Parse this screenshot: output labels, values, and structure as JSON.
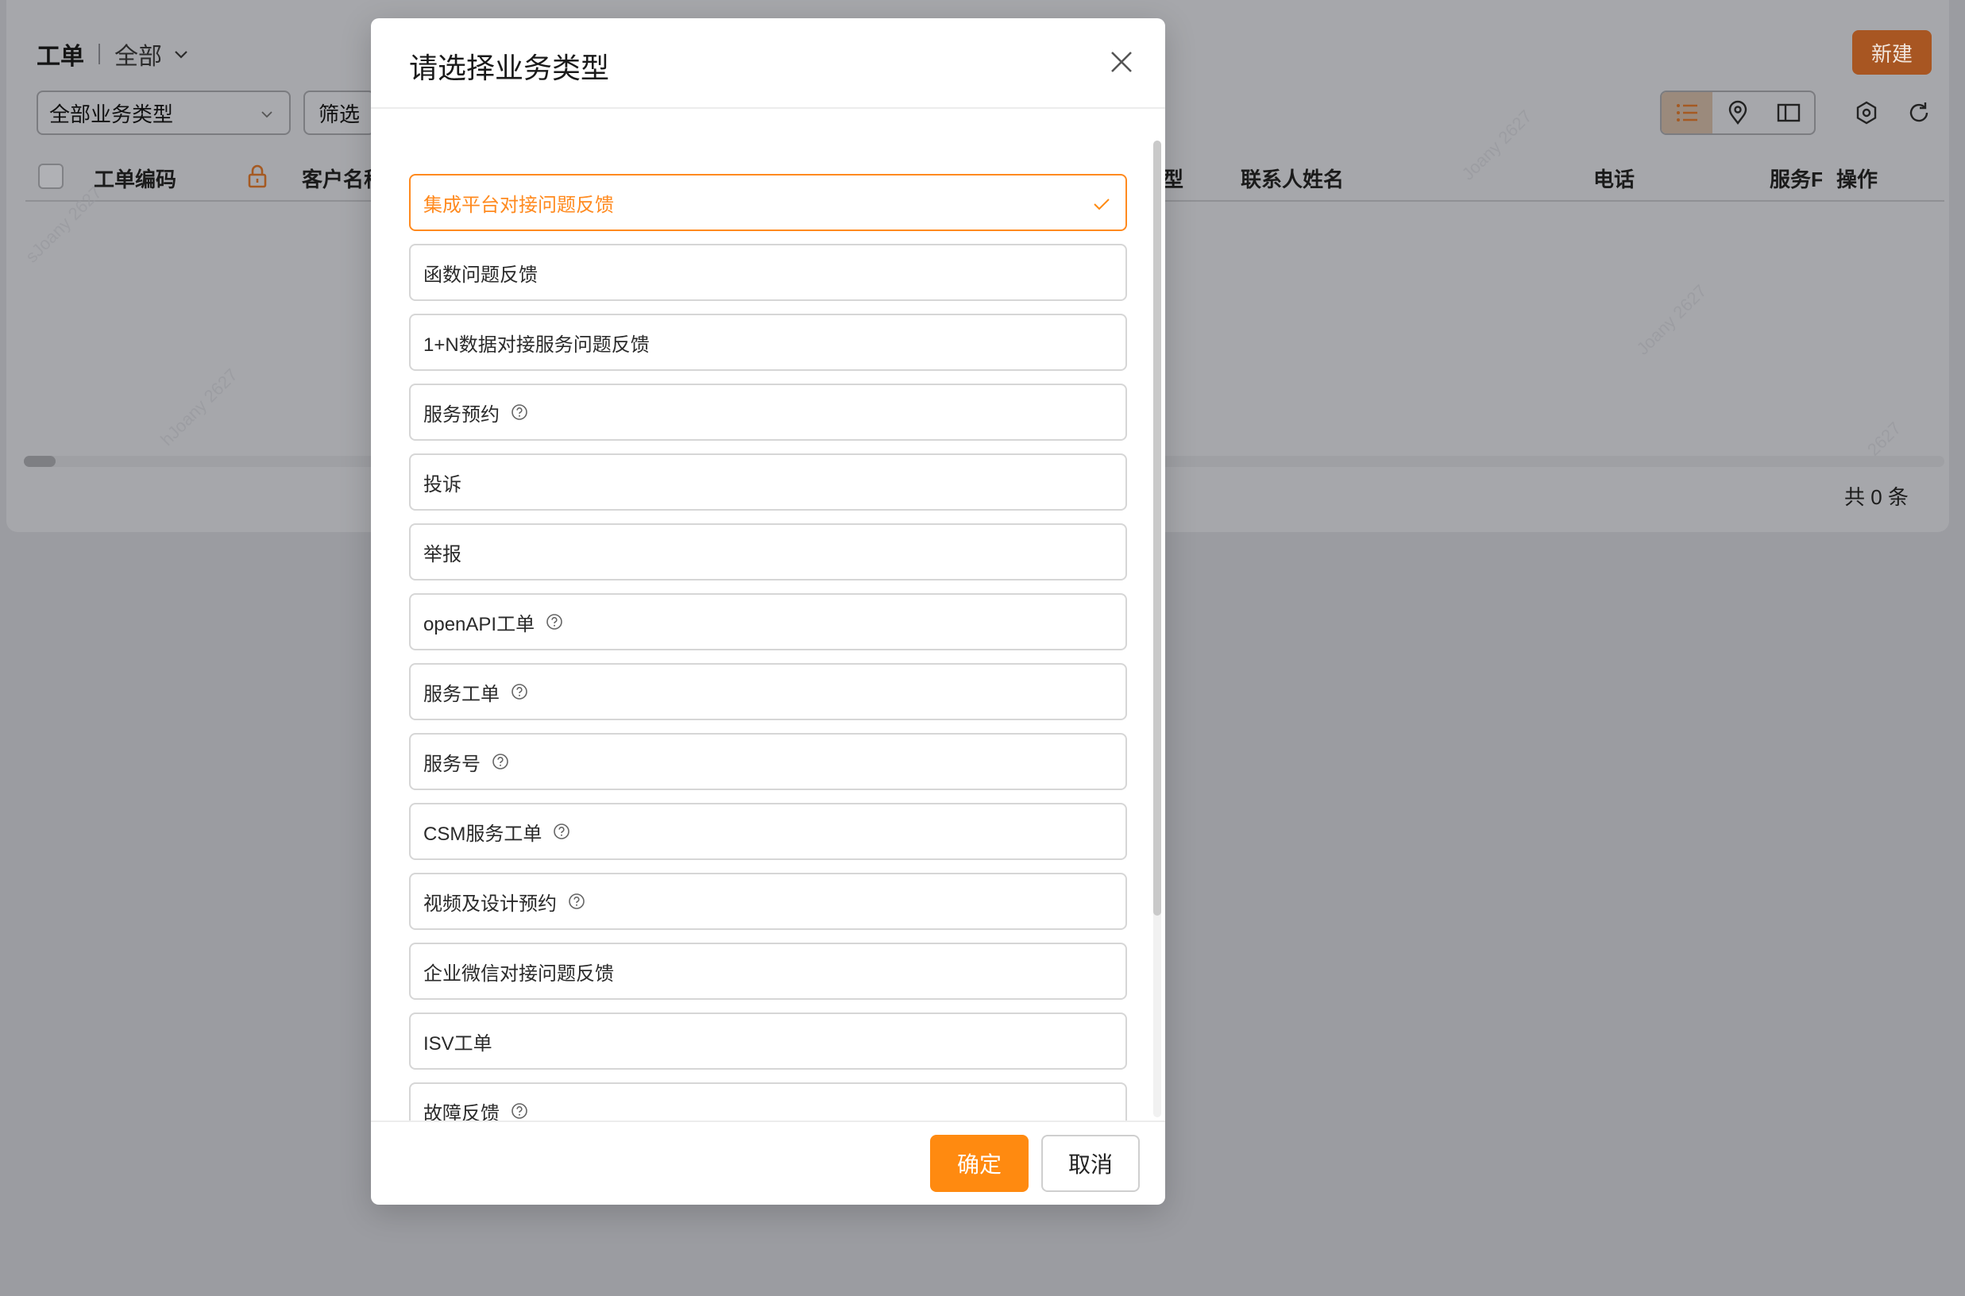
{
  "page": {
    "title": "工单",
    "view_selector": "全部",
    "new_button": "新建",
    "type_filter_value": "全部业务类型",
    "filter_button": "筛选",
    "table": {
      "columns": [
        "工单编码",
        "客户名称",
        "型",
        "联系人姓名",
        "电话",
        "服务F",
        "操作"
      ]
    },
    "total_text": "共 0 条",
    "watermarks": [
      "sJoany 2627",
      "hJoany 2627",
      "Joany 2627",
      "Joany 2627",
      "2627"
    ]
  },
  "modal": {
    "title": "请选择业务类型",
    "options": [
      {
        "label": "集成平台对接问题反馈",
        "selected": true,
        "help": false
      },
      {
        "label": "函数问题反馈",
        "selected": false,
        "help": false
      },
      {
        "label": "1+N数据对接服务问题反馈",
        "selected": false,
        "help": false
      },
      {
        "label": "服务预约",
        "selected": false,
        "help": true
      },
      {
        "label": "投诉",
        "selected": false,
        "help": false
      },
      {
        "label": "举报",
        "selected": false,
        "help": false
      },
      {
        "label": "openAPI工单",
        "selected": false,
        "help": true
      },
      {
        "label": "服务工单",
        "selected": false,
        "help": true
      },
      {
        "label": "服务号",
        "selected": false,
        "help": true
      },
      {
        "label": "CSM服务工单",
        "selected": false,
        "help": true
      },
      {
        "label": "视频及设计预约",
        "selected": false,
        "help": true
      },
      {
        "label": "企业微信对接问题反馈",
        "selected": false,
        "help": false
      },
      {
        "label": "ISV工单",
        "selected": false,
        "help": false
      },
      {
        "label": "故障反馈",
        "selected": false,
        "help": true
      }
    ],
    "confirm_button": "确定",
    "cancel_button": "取消"
  },
  "colors": {
    "accent": "#ff8a10",
    "overlay": "#9b9ca1"
  }
}
